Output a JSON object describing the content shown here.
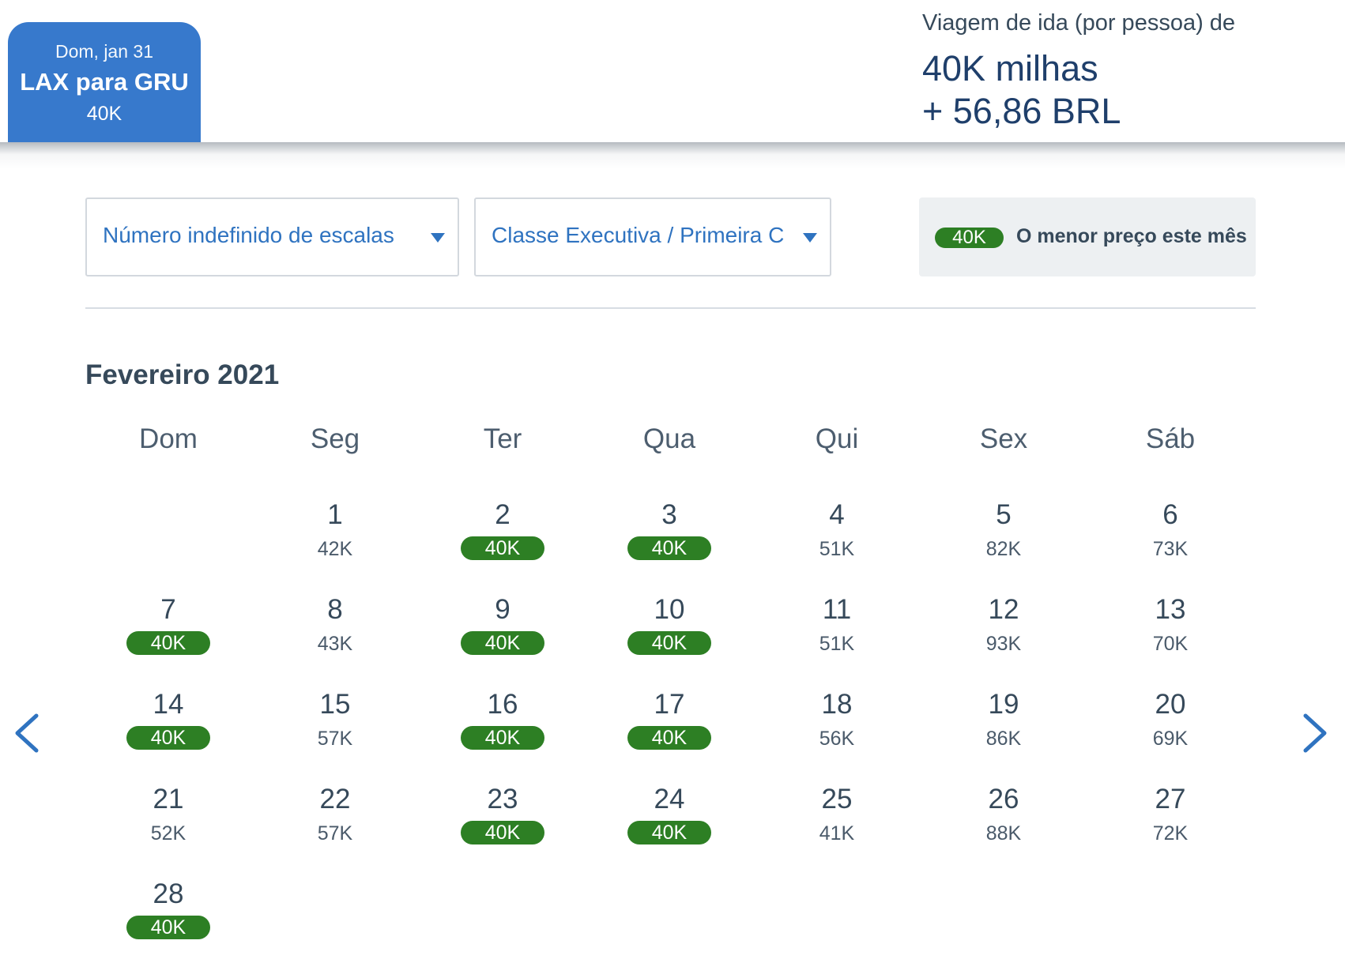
{
  "header": {
    "trip_tab": {
      "date": "Dom, jan 31",
      "route": "LAX para GRU",
      "price": "40K"
    },
    "fare": {
      "label": "Viagem de ida (por pessoa) de",
      "miles": "40K milhas",
      "cash": "+ 56,86 BRL"
    }
  },
  "filters": {
    "stops": "Número indefinido de escalas",
    "cabin": "Classe Executiva / Primeira Classe",
    "legend_pill": "40K",
    "legend_text": "O menor preço este mês"
  },
  "calendar": {
    "month": "Fevereiro 2021",
    "weekdays": [
      "Dom",
      "Seg",
      "Ter",
      "Qua",
      "Qui",
      "Sex",
      "Sáb"
    ],
    "first_weekday_index": 1,
    "days": [
      {
        "day": "1",
        "price": "42K",
        "lowest": false
      },
      {
        "day": "2",
        "price": "40K",
        "lowest": true
      },
      {
        "day": "3",
        "price": "40K",
        "lowest": true
      },
      {
        "day": "4",
        "price": "51K",
        "lowest": false
      },
      {
        "day": "5",
        "price": "82K",
        "lowest": false
      },
      {
        "day": "6",
        "price": "73K",
        "lowest": false
      },
      {
        "day": "7",
        "price": "40K",
        "lowest": true
      },
      {
        "day": "8",
        "price": "43K",
        "lowest": false
      },
      {
        "day": "9",
        "price": "40K",
        "lowest": true
      },
      {
        "day": "10",
        "price": "40K",
        "lowest": true
      },
      {
        "day": "11",
        "price": "51K",
        "lowest": false
      },
      {
        "day": "12",
        "price": "93K",
        "lowest": false
      },
      {
        "day": "13",
        "price": "70K",
        "lowest": false
      },
      {
        "day": "14",
        "price": "40K",
        "lowest": true
      },
      {
        "day": "15",
        "price": "57K",
        "lowest": false
      },
      {
        "day": "16",
        "price": "40K",
        "lowest": true
      },
      {
        "day": "17",
        "price": "40K",
        "lowest": true
      },
      {
        "day": "18",
        "price": "56K",
        "lowest": false
      },
      {
        "day": "19",
        "price": "86K",
        "lowest": false
      },
      {
        "day": "20",
        "price": "69K",
        "lowest": false
      },
      {
        "day": "21",
        "price": "52K",
        "lowest": false
      },
      {
        "day": "22",
        "price": "57K",
        "lowest": false
      },
      {
        "day": "23",
        "price": "40K",
        "lowest": true
      },
      {
        "day": "24",
        "price": "40K",
        "lowest": true
      },
      {
        "day": "25",
        "price": "41K",
        "lowest": false
      },
      {
        "day": "26",
        "price": "88K",
        "lowest": false
      },
      {
        "day": "27",
        "price": "72K",
        "lowest": false
      },
      {
        "day": "28",
        "price": "40K",
        "lowest": true
      }
    ]
  },
  "navigation": {
    "prev_icon": "chevron-left-icon",
    "next_icon": "chevron-right-icon"
  },
  "colors": {
    "tab_blue": "#3779cc",
    "lowest_green": "#2d7f24",
    "link_blue": "#2f73c0",
    "fare_navy": "#1f3f6b"
  }
}
